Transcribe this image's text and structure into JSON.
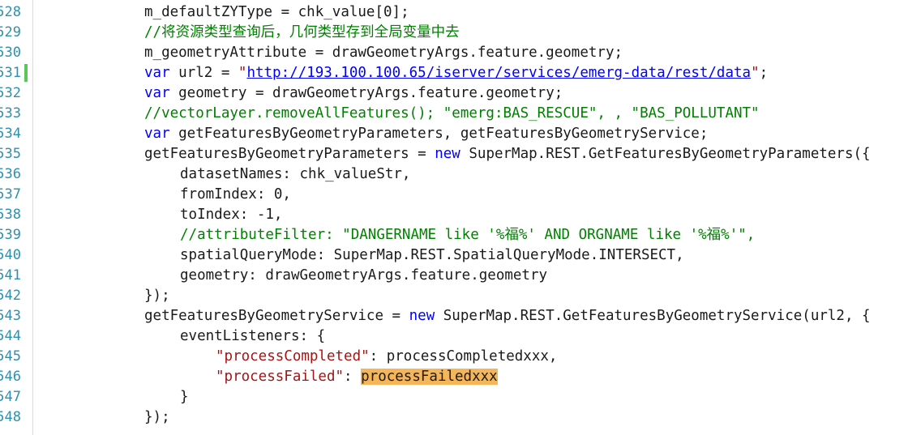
{
  "editor": {
    "lines": [
      {
        "num": "528",
        "parts": [
          {
            "t": "m_defaultZYType = chk_value[0];",
            "c": ""
          }
        ]
      },
      {
        "num": "529",
        "parts": [
          {
            "t": "//将资源类型查询后，几何类型存到全局变量中去",
            "c": "cm"
          }
        ]
      },
      {
        "num": "530",
        "parts": [
          {
            "t": "m_geometryAttribute = drawGeometryArgs.feature.geometry;",
            "c": ""
          }
        ]
      },
      {
        "num": "531",
        "parts": [
          {
            "t": "var",
            "c": "kw"
          },
          {
            "t": " url2 = ",
            "c": ""
          },
          {
            "t": "\"",
            "c": "str"
          },
          {
            "t": "http://193.100.100.65/iserver/services/emerg-data/rest/data",
            "c": "url"
          },
          {
            "t": "\"",
            "c": "str"
          },
          {
            "t": ";",
            "c": ""
          }
        ]
      },
      {
        "num": "532",
        "parts": [
          {
            "t": "var",
            "c": "kw"
          },
          {
            "t": " geometry = drawGeometryArgs.feature.geometry;",
            "c": ""
          }
        ]
      },
      {
        "num": "533",
        "parts": [
          {
            "t": "//vectorLayer.removeAllFeatures(); \"emerg:BAS_RESCUE\", , \"BAS_POLLUTANT\"",
            "c": "cm"
          }
        ]
      },
      {
        "num": "534",
        "parts": [
          {
            "t": "var",
            "c": "kw"
          },
          {
            "t": " getFeaturesByGeometryParameters, getFeaturesByGeometryService;",
            "c": ""
          }
        ]
      },
      {
        "num": "535",
        "parts": [
          {
            "t": "getFeaturesByGeometryParameters = ",
            "c": ""
          },
          {
            "t": "new",
            "c": "kw"
          },
          {
            "t": " SuperMap.REST.GetFeaturesByGeometryParameters({",
            "c": ""
          }
        ]
      },
      {
        "num": "536",
        "parts": [
          {
            "t": "datasetNames: chk_valueStr,",
            "c": ""
          }
        ]
      },
      {
        "num": "537",
        "parts": [
          {
            "t": "fromIndex: 0,",
            "c": ""
          }
        ]
      },
      {
        "num": "538",
        "parts": [
          {
            "t": "toIndex: -1,",
            "c": ""
          }
        ]
      },
      {
        "num": "539",
        "parts": [
          {
            "t": "//attributeFilter: \"DANGERNAME like '%福%' AND ORGNAME like '%福%'\",",
            "c": "cm"
          }
        ]
      },
      {
        "num": "540",
        "parts": [
          {
            "t": "spatialQueryMode: SuperMap.REST.SpatialQueryMode.INTERSECT,",
            "c": ""
          }
        ]
      },
      {
        "num": "541",
        "parts": [
          {
            "t": "geometry: drawGeometryArgs.feature.geometry",
            "c": ""
          }
        ]
      },
      {
        "num": "542",
        "parts": [
          {
            "t": "});",
            "c": ""
          }
        ]
      },
      {
        "num": "543",
        "parts": [
          {
            "t": "getFeaturesByGeometryService = ",
            "c": ""
          },
          {
            "t": "new",
            "c": "kw"
          },
          {
            "t": " SuperMap.REST.GetFeaturesByGeometryService(url2, {",
            "c": ""
          }
        ]
      },
      {
        "num": "544",
        "parts": [
          {
            "t": "eventListeners: {",
            "c": ""
          }
        ]
      },
      {
        "num": "545",
        "parts": [
          {
            "t": "\"processCompleted\"",
            "c": "str"
          },
          {
            "t": ": processCompletedxxx,",
            "c": ""
          }
        ]
      },
      {
        "num": "546",
        "parts": [
          {
            "t": "\"processFailed\"",
            "c": "str"
          },
          {
            "t": ": ",
            "c": ""
          },
          {
            "t": "processFailedxxx",
            "c": "hl"
          }
        ]
      },
      {
        "num": "547",
        "parts": [
          {
            "t": "}",
            "c": ""
          }
        ]
      },
      {
        "num": "548",
        "parts": [
          {
            "t": "});",
            "c": ""
          }
        ]
      }
    ]
  }
}
